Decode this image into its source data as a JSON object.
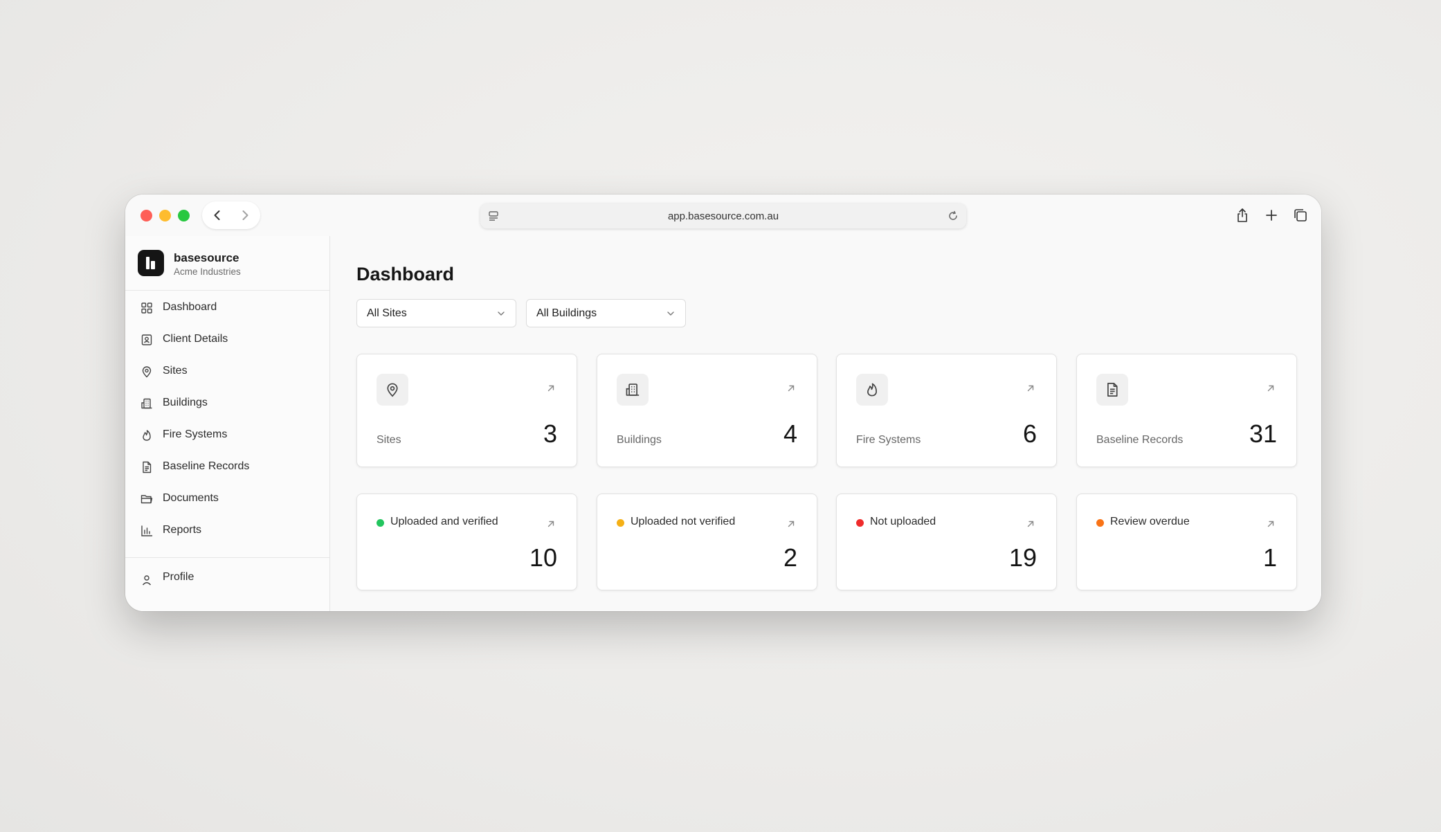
{
  "browser": {
    "url": "app.basesource.com.au"
  },
  "brand": {
    "name": "basesource",
    "subtitle": "Acme Industries"
  },
  "sidebar": {
    "items": [
      {
        "label": "Dashboard",
        "icon": "grid-icon"
      },
      {
        "label": "Client Details",
        "icon": "contact-card-icon"
      },
      {
        "label": "Sites",
        "icon": "map-pin-icon"
      },
      {
        "label": "Buildings",
        "icon": "building-icon"
      },
      {
        "label": "Fire Systems",
        "icon": "flame-icon"
      },
      {
        "label": "Baseline Records",
        "icon": "file-text-icon"
      },
      {
        "label": "Documents",
        "icon": "folder-icon"
      },
      {
        "label": "Reports",
        "icon": "bar-chart-icon"
      }
    ],
    "footer": {
      "label": "Profile",
      "icon": "user-icon"
    }
  },
  "main": {
    "title": "Dashboard",
    "filters": [
      {
        "label": "All Sites"
      },
      {
        "label": "All Buildings"
      }
    ],
    "stats": [
      {
        "label": "Sites",
        "value": "3",
        "icon": "map-pin-icon"
      },
      {
        "label": "Buildings",
        "value": "4",
        "icon": "building-icon"
      },
      {
        "label": "Fire Systems",
        "value": "6",
        "icon": "flame-icon"
      },
      {
        "label": "Baseline Records",
        "value": "31",
        "icon": "file-text-icon"
      }
    ],
    "statuses": [
      {
        "label": "Uploaded and verified",
        "value": "10",
        "color": "#22c55e"
      },
      {
        "label": "Uploaded not verified",
        "value": "2",
        "color": "#f5b016"
      },
      {
        "label": "Not uploaded",
        "value": "19",
        "color": "#ef2b2b"
      },
      {
        "label": "Review overdue",
        "value": "1",
        "color": "#f97316"
      }
    ]
  }
}
